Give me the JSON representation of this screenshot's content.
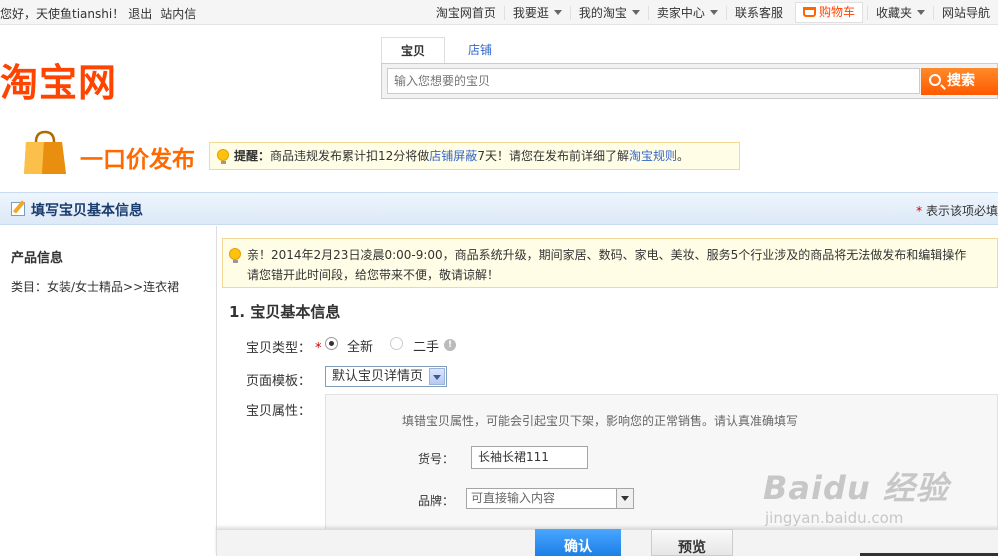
{
  "topbar": {
    "greeting": "您好，天使鱼tianshi！",
    "logout": "退出",
    "messages": "站内信",
    "nav": [
      {
        "label": "淘宝网首页",
        "dropdown": false
      },
      {
        "label": "我要逛",
        "dropdown": true
      },
      {
        "label": "我的淘宝",
        "dropdown": true
      },
      {
        "label": "卖家中心",
        "dropdown": true
      },
      {
        "label": "联系客服",
        "dropdown": false
      }
    ],
    "cart": "购物车",
    "favorites": "收藏夹",
    "sitenav": "网站导航"
  },
  "header": {
    "logo": "淘宝网",
    "tabs": [
      "宝贝",
      "店铺"
    ],
    "search_placeholder": "输入您想要的宝贝",
    "search_button": "搜索"
  },
  "publish": {
    "title": "一口价发布",
    "reminder_label": "提醒：",
    "reminder_text1": "商品违规发布累计扣12分将做",
    "reminder_link1": "店铺屏蔽",
    "reminder_text2": "7天！请您在发布前详细了解",
    "reminder_link2": "淘宝规则",
    "reminder_end": "。"
  },
  "section": {
    "title": "填写宝贝基本信息",
    "required_note_star": "*",
    "required_note": "表示该项必填"
  },
  "left": {
    "product_info": "产品信息",
    "category": "类目：女装/女士精品>>连衣裙"
  },
  "notice": {
    "line1": "亲！2014年2月23日凌晨0:00-9:00，商品系统升级，期间家居、数码、家电、美妆、服务5个行业涉及的商品将无法做发布和编辑操作",
    "line2": "请您错开此时间段，给您带来不便，敬请谅解！"
  },
  "form": {
    "heading": "1. 宝贝基本信息",
    "type_label": "宝贝类型：",
    "type_star": "*",
    "type_new": "全新",
    "type_used": "二手",
    "template_label": "页面模板：",
    "template_value": "默认宝贝详情页",
    "attr_label": "宝贝属性：",
    "attr_hint": "填错宝贝属性，可能会引起宝贝下架，影响您的正常销售。请认真准确填写",
    "item_no_label": "货号：",
    "item_no_value": "长袖长裙111",
    "brand_label": "品牌：",
    "brand_placeholder": "可直接输入内容"
  },
  "footer": {
    "confirm": "确认",
    "preview": "预览"
  },
  "watermark": {
    "brand": "Baidu 经验",
    "url": "jingyan.baidu.com"
  },
  "colors": {
    "accent": "#ff4400",
    "link": "#3366cc",
    "confirm": "#1c7fe6"
  }
}
